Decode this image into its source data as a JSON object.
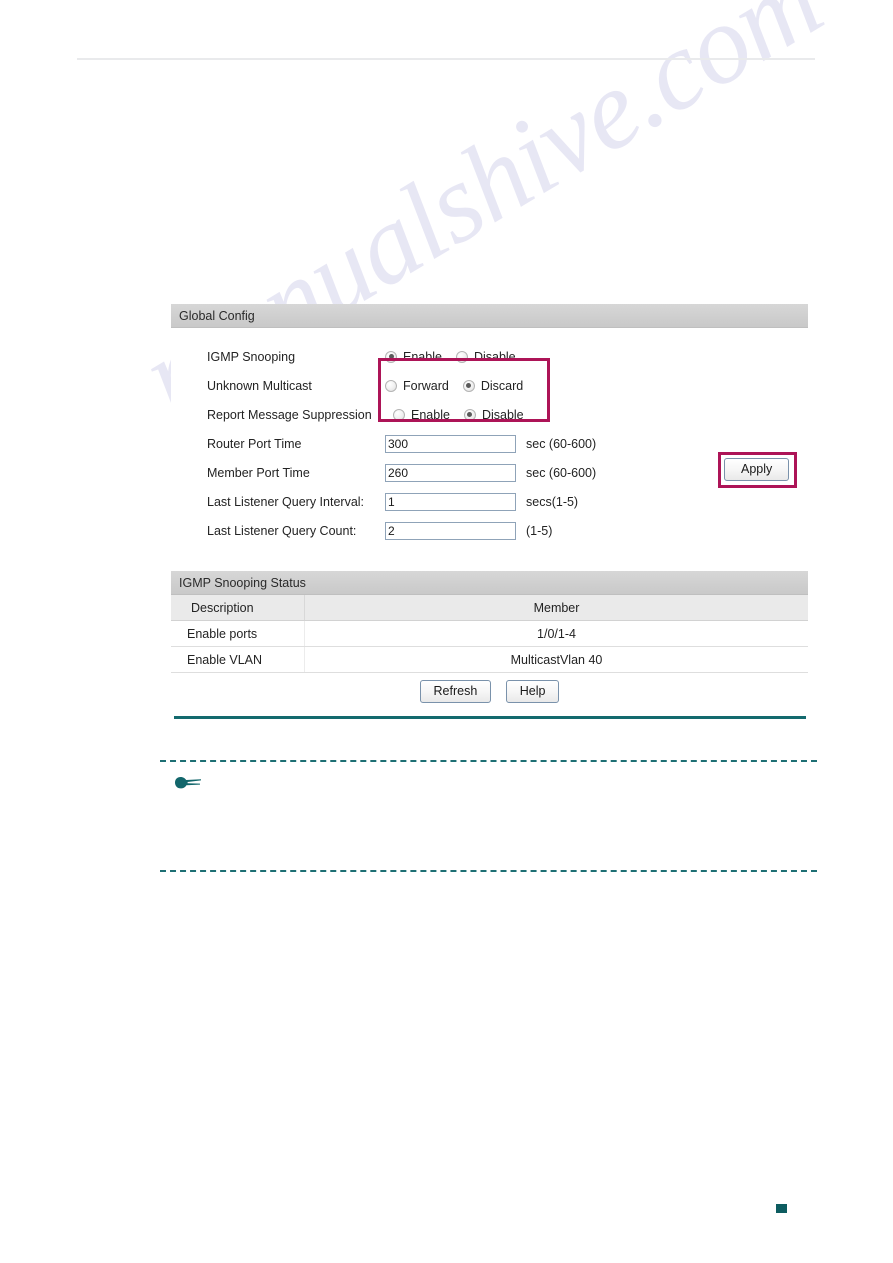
{
  "watermark": {
    "text": "manualshive.com"
  },
  "global_config": {
    "panel_title": "Global Config",
    "rows": {
      "igmp_snooping": {
        "label": "IGMP Snooping",
        "options": [
          {
            "label": "Enable",
            "selected": true
          },
          {
            "label": "Disable",
            "selected": false
          }
        ]
      },
      "unknown_multicast": {
        "label": "Unknown Multicast",
        "options": [
          {
            "label": "Forward",
            "selected": false
          },
          {
            "label": "Discard",
            "selected": true
          }
        ]
      },
      "report_message_suppression": {
        "label": "Report Message Suppression",
        "options": [
          {
            "label": "Enable",
            "selected": false
          },
          {
            "label": "Disable",
            "selected": true
          }
        ]
      },
      "router_port_time": {
        "label": "Router Port Time",
        "value": "300",
        "unit": "sec (60-600)"
      },
      "member_port_time": {
        "label": "Member Port Time",
        "value": "260",
        "unit": "sec (60-600)"
      },
      "last_listener_query_interval": {
        "label": "Last Listener Query Interval:",
        "value": "1",
        "unit": "secs(1-5)"
      },
      "last_listener_query_count": {
        "label": "Last Listener Query Count:",
        "value": "2",
        "unit": "(1-5)"
      }
    },
    "apply_label": "Apply",
    "highlight_color": "#ad1457"
  },
  "status": {
    "panel_title": "IGMP Snooping Status",
    "columns": [
      "Description",
      "Member"
    ],
    "rows": [
      {
        "description": "Enable ports",
        "member": "1/0/1-4"
      },
      {
        "description": "Enable VLAN",
        "member": "MulticastVlan 40"
      }
    ],
    "refresh_label": "Refresh",
    "help_label": "Help"
  },
  "note": {
    "icon": "pointing-hand-icon",
    "text": ""
  },
  "theme": {
    "teal_rule": "#136a6e",
    "dashed_border": "#1d6f74",
    "page_marker": "#0d5c60"
  }
}
